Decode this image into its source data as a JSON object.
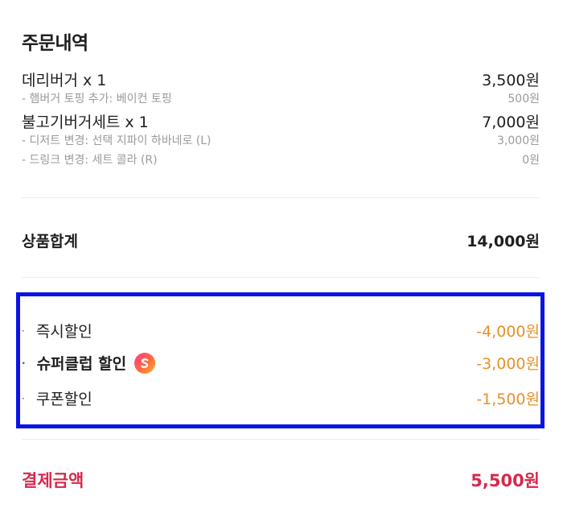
{
  "order": {
    "title": "주문내역",
    "items": [
      {
        "label": "데리버거 x 1",
        "price": "3,500원"
      },
      {
        "label": "- 햄버거 토핑 추가: 베이컨 토핑",
        "price": "500원"
      },
      {
        "label": "불고기버거세트 x 1",
        "price": "7,000원"
      },
      {
        "label": "- 디저트 변경: 선택 지파이 하바네로 (L)",
        "price": "3,000원"
      },
      {
        "label": "- 드링크 변경: 세트 콜라 (R)",
        "price": "0원"
      }
    ]
  },
  "subtotal": {
    "label": "상품합계",
    "value": "14,000원"
  },
  "discounts": {
    "bullet": "·",
    "items": [
      {
        "label": "즉시할인",
        "value": "-4,000원"
      },
      {
        "label": "슈퍼클럽 할인",
        "value": "-3,000원",
        "icon": "super-club-badge-icon"
      },
      {
        "label": "쿠폰할인",
        "value": "-1,500원"
      }
    ]
  },
  "total": {
    "label": "결제금액",
    "value": "5,500원"
  },
  "colors": {
    "discount": "#e8902a",
    "total": "#d8284d",
    "highlight_box": "#0a14e6"
  }
}
